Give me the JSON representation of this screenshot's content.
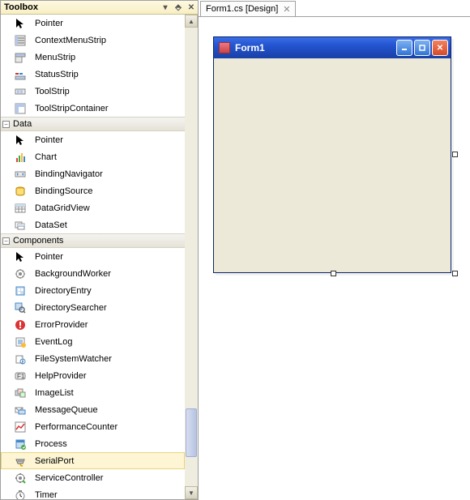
{
  "toolbox": {
    "title": "Toolbox",
    "categories": [
      {
        "name": "Data",
        "items": [
          {
            "icon": "pointer-icon",
            "label": "Pointer"
          },
          {
            "icon": "chart-icon",
            "label": "Chart"
          },
          {
            "icon": "binding-navigator-icon",
            "label": "BindingNavigator"
          },
          {
            "icon": "binding-source-icon",
            "label": "BindingSource"
          },
          {
            "icon": "data-grid-view-icon",
            "label": "DataGridView"
          },
          {
            "icon": "data-set-icon",
            "label": "DataSet"
          }
        ]
      },
      {
        "name": "Components",
        "items": [
          {
            "icon": "pointer-icon",
            "label": "Pointer"
          },
          {
            "icon": "background-worker-icon",
            "label": "BackgroundWorker"
          },
          {
            "icon": "directory-entry-icon",
            "label": "DirectoryEntry"
          },
          {
            "icon": "directory-searcher-icon",
            "label": "DirectorySearcher"
          },
          {
            "icon": "error-provider-icon",
            "label": "ErrorProvider"
          },
          {
            "icon": "event-log-icon",
            "label": "EventLog"
          },
          {
            "icon": "file-system-watcher-icon",
            "label": "FileSystemWatcher"
          },
          {
            "icon": "help-provider-icon",
            "label": "HelpProvider"
          },
          {
            "icon": "image-list-icon",
            "label": "ImageList"
          },
          {
            "icon": "message-queue-icon",
            "label": "MessageQueue"
          },
          {
            "icon": "performance-counter-icon",
            "label": "PerformanceCounter"
          },
          {
            "icon": "process-icon",
            "label": "Process"
          },
          {
            "icon": "serial-port-icon",
            "label": "SerialPort",
            "selected": true
          },
          {
            "icon": "service-controller-icon",
            "label": "ServiceController"
          },
          {
            "icon": "timer-icon",
            "label": "Timer"
          }
        ]
      }
    ],
    "top_visible_items": [
      {
        "icon": "pointer-icon",
        "label": "Pointer"
      },
      {
        "icon": "context-menu-strip-icon",
        "label": "ContextMenuStrip"
      },
      {
        "icon": "menu-strip-icon",
        "label": "MenuStrip"
      },
      {
        "icon": "status-strip-icon",
        "label": "StatusStrip"
      },
      {
        "icon": "tool-strip-icon",
        "label": "ToolStrip"
      },
      {
        "icon": "tool-strip-container-icon",
        "label": "ToolStripContainer"
      }
    ]
  },
  "designer": {
    "tab_label": "Form1.cs [Design]",
    "form_title": "Form1"
  }
}
